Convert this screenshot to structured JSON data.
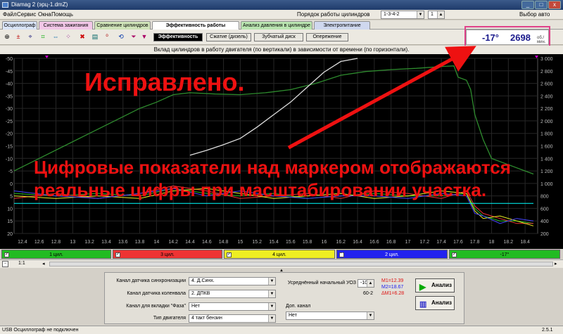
{
  "window": {
    "title": "Diamag 2 (эрц-1.dmZ)",
    "min": "_",
    "max": "□",
    "close": "x"
  },
  "menu": [
    "Файл",
    "Сервис",
    "Окна",
    "Помощь"
  ],
  "order": {
    "label": "Порядок работы цилиндров",
    "value": "1-3-4-2",
    "cyl": "1"
  },
  "auto_label": "Выбор авто",
  "tabs": [
    {
      "label": "Осциллограф",
      "color": "#d9e4f7"
    },
    {
      "label": "Система зажигания",
      "color": "#f2c7e8"
    },
    {
      "label": "Сравнение цилиндров",
      "color": "#cfe3b8"
    },
    {
      "label": "Эффективность работы цилиндров",
      "color": "#ffffff"
    },
    {
      "label": "Анализ давления в цилиндре",
      "color": "#b9e4b0"
    },
    {
      "label": "Электропитание",
      "color": "#cfd8ef"
    }
  ],
  "subtabs": [
    "Эффективность",
    "Сжатие (дизель)",
    "Зубчатый диск",
    "Опережение"
  ],
  "rpm": {
    "angle": "-17°",
    "value": "2698",
    "unit": "об./мин."
  },
  "chart_title": "Вклад цилиндров в работу двигателя (по вертикали) в зависимости от времени (по горизонтали).",
  "chart_data": {
    "type": "line",
    "x_ticks": [
      "12.4",
      "12.6",
      "12.8",
      "13",
      "13.2",
      "13.4",
      "13.6",
      "13.8",
      "14",
      "14.2",
      "14.4",
      "14.6",
      "14.8",
      "15",
      "15.2",
      "15.4",
      "15.6",
      "15.8",
      "16",
      "16.2",
      "16.4",
      "16.6",
      "16.8",
      "17",
      "17.2",
      "17.4",
      "17.6",
      "17.8",
      "18",
      "18.2",
      "18.4"
    ],
    "left_ticks": [
      "-50",
      "-45",
      "-40",
      "-35",
      "-30",
      "-25",
      "-20",
      "-15",
      "-10",
      "-5",
      "0",
      "5",
      "10",
      "15",
      "20"
    ],
    "right_ticks": [
      "3 000",
      "2 800",
      "2 600",
      "2 400",
      "2 200",
      "2 000",
      "1 800",
      "1 600",
      "1 400",
      "1 200",
      "1 000",
      "800",
      "600",
      "400",
      "200"
    ],
    "xlim": [
      12.3,
      18.55
    ],
    "ylim_left": [
      -50,
      20
    ],
    "ylim_right": [
      3000,
      200
    ],
    "series": [
      {
        "name": "rpm",
        "color": "#2e8b2e",
        "axis": "right",
        "x": [
          12.3,
          12.6,
          12.9,
          13.2,
          13.5,
          13.8,
          14.0,
          14.2,
          14.4,
          14.7,
          15.0,
          15.3,
          15.6,
          15.9,
          16.2,
          16.5,
          16.8,
          17.1,
          17.4,
          17.55,
          17.6,
          17.7,
          17.75,
          17.8,
          17.9,
          18.0,
          18.2,
          18.4,
          18.5
        ],
        "y": [
          1200,
          1400,
          1600,
          1800,
          2000,
          2200,
          2300,
          2420,
          2450,
          2430,
          2420,
          2450,
          2500,
          2600,
          2730,
          2790,
          2820,
          2840,
          2870,
          2880,
          2700,
          2650,
          2500,
          2100,
          1700,
          1400,
          1300,
          1200,
          1150
        ]
      },
      {
        "name": "throttle",
        "color": "#dddddd",
        "axis": "right",
        "x": [
          14.4,
          14.6,
          14.8,
          15.0,
          15.2,
          15.4,
          15.6,
          15.8,
          16.0,
          16.2,
          16.4
        ],
        "y": [
          1450,
          1530,
          1620,
          1720,
          1900,
          2100,
          2300,
          2540,
          2780,
          2950,
          3000
        ]
      },
      {
        "name": "1 цил.",
        "color": "#22bb22",
        "axis": "left",
        "x": [
          12.3,
          12.8,
          13.3,
          13.8,
          14.2,
          14.6,
          15.0,
          15.4,
          15.8,
          16.2,
          16.6,
          17.0,
          17.4,
          17.7,
          17.8,
          17.9,
          18.1,
          18.3,
          18.5
        ],
        "y": [
          4,
          5,
          4,
          5,
          2,
          4,
          5,
          4,
          6,
          5,
          4,
          5,
          5,
          4,
          10,
          13,
          15,
          15,
          16
        ]
      },
      {
        "name": "3 цил.",
        "color": "#ee3333",
        "axis": "left",
        "x": [
          12.3,
          12.8,
          13.3,
          13.8,
          14.2,
          14.6,
          15.0,
          15.4,
          15.8,
          16.2,
          16.6,
          17.0,
          17.4,
          17.7,
          17.8,
          17.9,
          18.1,
          18.3,
          18.5
        ],
        "y": [
          6,
          4,
          6,
          4,
          1,
          3,
          6,
          5,
          4,
          6,
          3,
          4,
          6,
          3,
          9,
          12,
          14,
          16,
          16
        ]
      },
      {
        "name": "4 цил.",
        "color": "#eeee22",
        "axis": "left",
        "x": [
          12.3,
          12.8,
          13.3,
          13.8,
          14.2,
          14.6,
          15.0,
          15.4,
          15.8,
          16.2,
          16.6,
          17.0,
          17.4,
          17.7,
          17.8,
          17.9,
          18.1,
          18.3,
          18.5
        ],
        "y": [
          5,
          6,
          5,
          6,
          3,
          2,
          4,
          6,
          5,
          4,
          6,
          5,
          3,
          4,
          11,
          14,
          13,
          15,
          17
        ]
      },
      {
        "name": "2 цил.",
        "color": "#4444ff",
        "axis": "left",
        "x": [
          12.3,
          12.8,
          13.3,
          13.8,
          14.2,
          14.6,
          15.0,
          15.4,
          15.8,
          16.2,
          16.6,
          17.0,
          17.4,
          17.7,
          17.8,
          17.9,
          18.1,
          18.3,
          18.5
        ],
        "y": [
          3,
          5,
          6,
          4,
          2,
          5,
          3,
          5,
          6,
          5,
          5,
          6,
          4,
          5,
          12,
          13,
          16,
          14,
          15
        ]
      },
      {
        "name": "-17°",
        "color": "#00ffff",
        "axis": "left",
        "x": [
          12.3,
          18.5
        ],
        "y": [
          8,
          8
        ]
      }
    ]
  },
  "legend": [
    {
      "label": "1 цил.",
      "color": "#22bb22"
    },
    {
      "label": "3 цил.",
      "color": "#ee3333"
    },
    {
      "label": "4 цил.",
      "color": "#eeee22"
    },
    {
      "label": "2 цил.",
      "color": "#2222ee"
    },
    {
      "label": "-17°",
      "color": "#22bb22"
    }
  ],
  "zoom": "1:1",
  "form": {
    "sync_label": "Канал датчика синхронизации",
    "sync_value": "4. Д.Синх.",
    "crank_label": "Канал датчика коленвала",
    "crank_value": "2. ДПКВ",
    "phase_label": "Канал для вкладки \"Фаза\"",
    "phase_value": "Нет",
    "engine_label": "Тип двигателя",
    "engine_value": "4 такт бензин",
    "uoz_label": "Усреднённый начальный УОЗ",
    "uoz_value": "-10",
    "gear": "60-2",
    "extra_label": "Доп. канал",
    "extra_value": "Нет",
    "m1": "M1=12.39",
    "m2": "M2=18.67",
    "dm1": "ΔM1=6.28"
  },
  "buttons": {
    "analyze1": "Анализ",
    "analyze2": "Анализ"
  },
  "status": {
    "left": "USB Осциллограф не подключен",
    "version": "2.5.1"
  },
  "overlay": {
    "line1": "Исправлено.",
    "line2": "Цифровые показатели над маркером отображаются",
    "line3": "реальные цифры при масштабировании участка."
  }
}
